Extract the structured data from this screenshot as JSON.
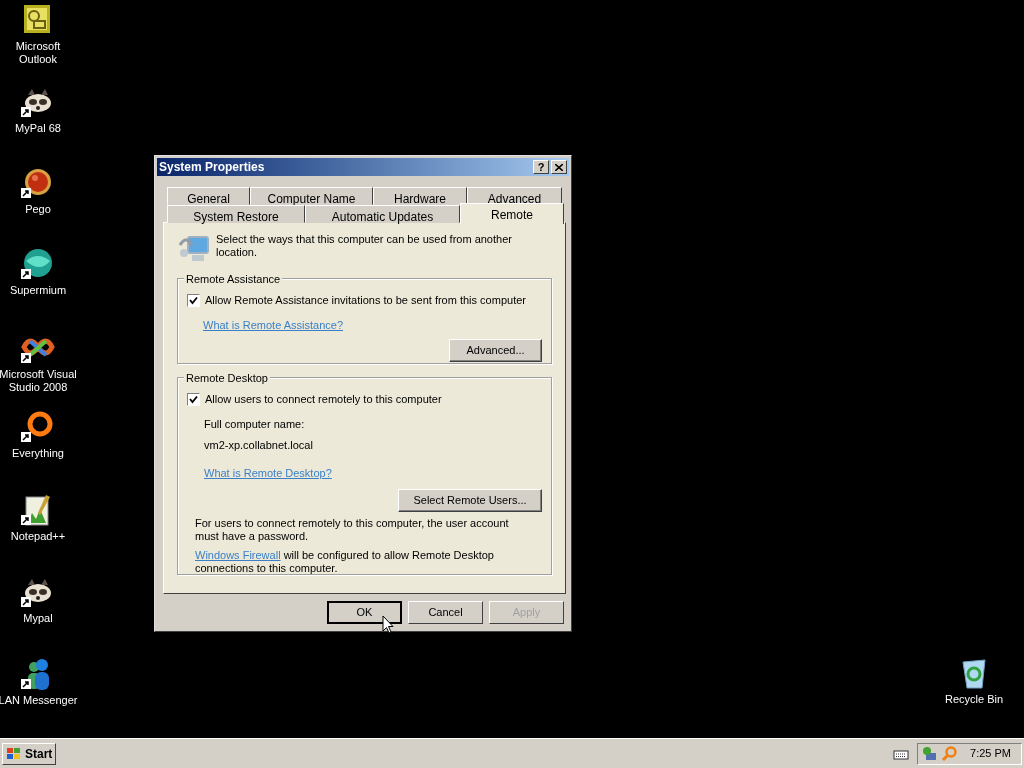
{
  "desktop_icons": [
    {
      "label": "Microsoft Outlook",
      "kind": "outlook",
      "shortcut": false
    },
    {
      "label": "MyPal 68",
      "kind": "raccoon",
      "shortcut": true
    },
    {
      "label": "Pego",
      "kind": "pego",
      "shortcut": true
    },
    {
      "label": "Supermium",
      "kind": "supermium",
      "shortcut": true
    },
    {
      "label": "Microsoft Visual Studio 2008",
      "kind": "vs",
      "shortcut": true
    },
    {
      "label": "Everything",
      "kind": "everything",
      "shortcut": true
    },
    {
      "label": "Notepad++",
      "kind": "notepad",
      "shortcut": true
    },
    {
      "label": "Mypal",
      "kind": "raccoon",
      "shortcut": true
    },
    {
      "label": "LAN Messenger",
      "kind": "messenger",
      "shortcut": true
    },
    {
      "label": "Recycle Bin",
      "kind": "recycle",
      "shortcut": false
    }
  ],
  "window": {
    "title": "System Properties",
    "help_button": "?"
  },
  "tabs": [
    [
      {
        "label": "General",
        "selected": false
      },
      {
        "label": "Computer Name",
        "selected": false
      },
      {
        "label": "Hardware",
        "selected": false
      },
      {
        "label": "Advanced",
        "selected": false
      }
    ],
    [
      {
        "label": "System Restore",
        "selected": false
      },
      {
        "label": "Automatic Updates",
        "selected": false
      },
      {
        "label": "Remote",
        "selected": true
      }
    ]
  ],
  "intro": "Select the ways that this computer can be used from another location.",
  "remote_assistance": {
    "title": "Remote Assistance",
    "checkbox": {
      "label": "Allow Remote Assistance invitations to be sent from this computer",
      "checked": true
    },
    "link": "What is Remote Assistance?",
    "button": "Advanced..."
  },
  "remote_desktop": {
    "title": "Remote Desktop",
    "checkbox": {
      "label": "Allow users to connect remotely to this computer",
      "checked": true
    },
    "name_label": "Full computer name:",
    "name_value": "vm2-xp.collabnet.local",
    "link": "What is Remote Desktop?",
    "button": "Select Remote Users...",
    "note": "For users to connect remotely to this computer, the user account must have a password.",
    "firewall_link": "Windows Firewall",
    "firewall_text": "will be configured to allow Remote Desktop connections to this computer."
  },
  "buttons": [
    {
      "label": "OK",
      "default": true,
      "disabled": false
    },
    {
      "label": "Cancel",
      "default": false,
      "disabled": false
    },
    {
      "label": "Apply",
      "default": false,
      "disabled": true
    }
  ],
  "taskbar": {
    "start": "Start",
    "clock": "7:25 PM"
  }
}
